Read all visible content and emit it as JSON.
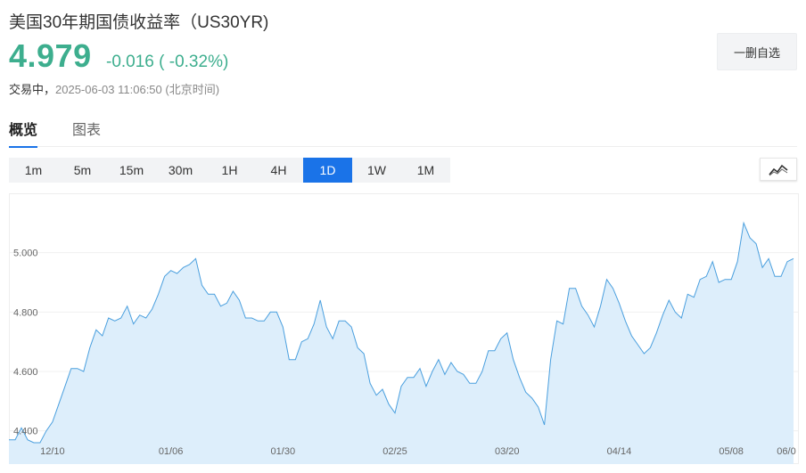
{
  "header": {
    "title": "美国30年期国债收益率（US30YR)",
    "price": "4.979",
    "change": "-0.016",
    "change_pct": "( -0.32%)",
    "status_label": "交易中，",
    "timestamp": "2025-06-03 11:06:50",
    "timezone": "(北京时间)",
    "fav_button_label": "一删自选",
    "color_down": "#3dae8e"
  },
  "tabs": [
    {
      "label": "概览",
      "active": true
    },
    {
      "label": "图表",
      "active": false
    }
  ],
  "periods": [
    {
      "label": "1m",
      "active": false
    },
    {
      "label": "5m",
      "active": false
    },
    {
      "label": "15m",
      "active": false
    },
    {
      "label": "30m",
      "active": false
    },
    {
      "label": "1H",
      "active": false
    },
    {
      "label": "4H",
      "active": false
    },
    {
      "label": "1D",
      "active": true
    },
    {
      "label": "1W",
      "active": false
    },
    {
      "label": "1M",
      "active": false
    }
  ],
  "chart_type_icon": "line-chart-icon",
  "chart_data": {
    "type": "area",
    "line_color": "#4a9fde",
    "fill_color": "#ddeefb",
    "ylim": [
      4.33,
      5.2
    ],
    "y_ticks": [
      "4.400",
      "4.600",
      "4.800",
      "5.000"
    ],
    "x_labels": [
      "12/10",
      "01/06",
      "01/30",
      "02/25",
      "03/20",
      "04/14",
      "05/08",
      "06/0"
    ],
    "x_label_index": [
      7,
      26,
      44,
      62,
      80,
      98,
      116,
      134
    ],
    "values": [
      4.37,
      4.37,
      4.41,
      4.37,
      4.36,
      4.36,
      4.4,
      4.43,
      4.49,
      4.55,
      4.61,
      4.61,
      4.6,
      4.68,
      4.74,
      4.72,
      4.78,
      4.77,
      4.78,
      4.82,
      4.76,
      4.79,
      4.78,
      4.81,
      4.86,
      4.92,
      4.94,
      4.93,
      4.95,
      4.96,
      4.98,
      4.89,
      4.86,
      4.86,
      4.82,
      4.83,
      4.87,
      4.84,
      4.78,
      4.78,
      4.77,
      4.77,
      4.8,
      4.8,
      4.75,
      4.64,
      4.64,
      4.7,
      4.71,
      4.76,
      4.84,
      4.75,
      4.71,
      4.77,
      4.77,
      4.75,
      4.68,
      4.66,
      4.56,
      4.52,
      4.54,
      4.49,
      4.46,
      4.55,
      4.58,
      4.58,
      4.61,
      4.55,
      4.6,
      4.64,
      4.59,
      4.63,
      4.6,
      4.59,
      4.56,
      4.56,
      4.6,
      4.67,
      4.67,
      4.71,
      4.73,
      4.64,
      4.58,
      4.53,
      4.51,
      4.48,
      4.42,
      4.64,
      4.77,
      4.76,
      4.88,
      4.88,
      4.82,
      4.79,
      4.75,
      4.82,
      4.91,
      4.88,
      4.83,
      4.77,
      4.72,
      4.69,
      4.66,
      4.68,
      4.73,
      4.79,
      4.84,
      4.8,
      4.78,
      4.86,
      4.85,
      4.91,
      4.92,
      4.97,
      4.9,
      4.91,
      4.91,
      4.97,
      5.1,
      5.05,
      5.03,
      4.95,
      4.98,
      4.92,
      4.92,
      4.97,
      4.98
    ]
  }
}
